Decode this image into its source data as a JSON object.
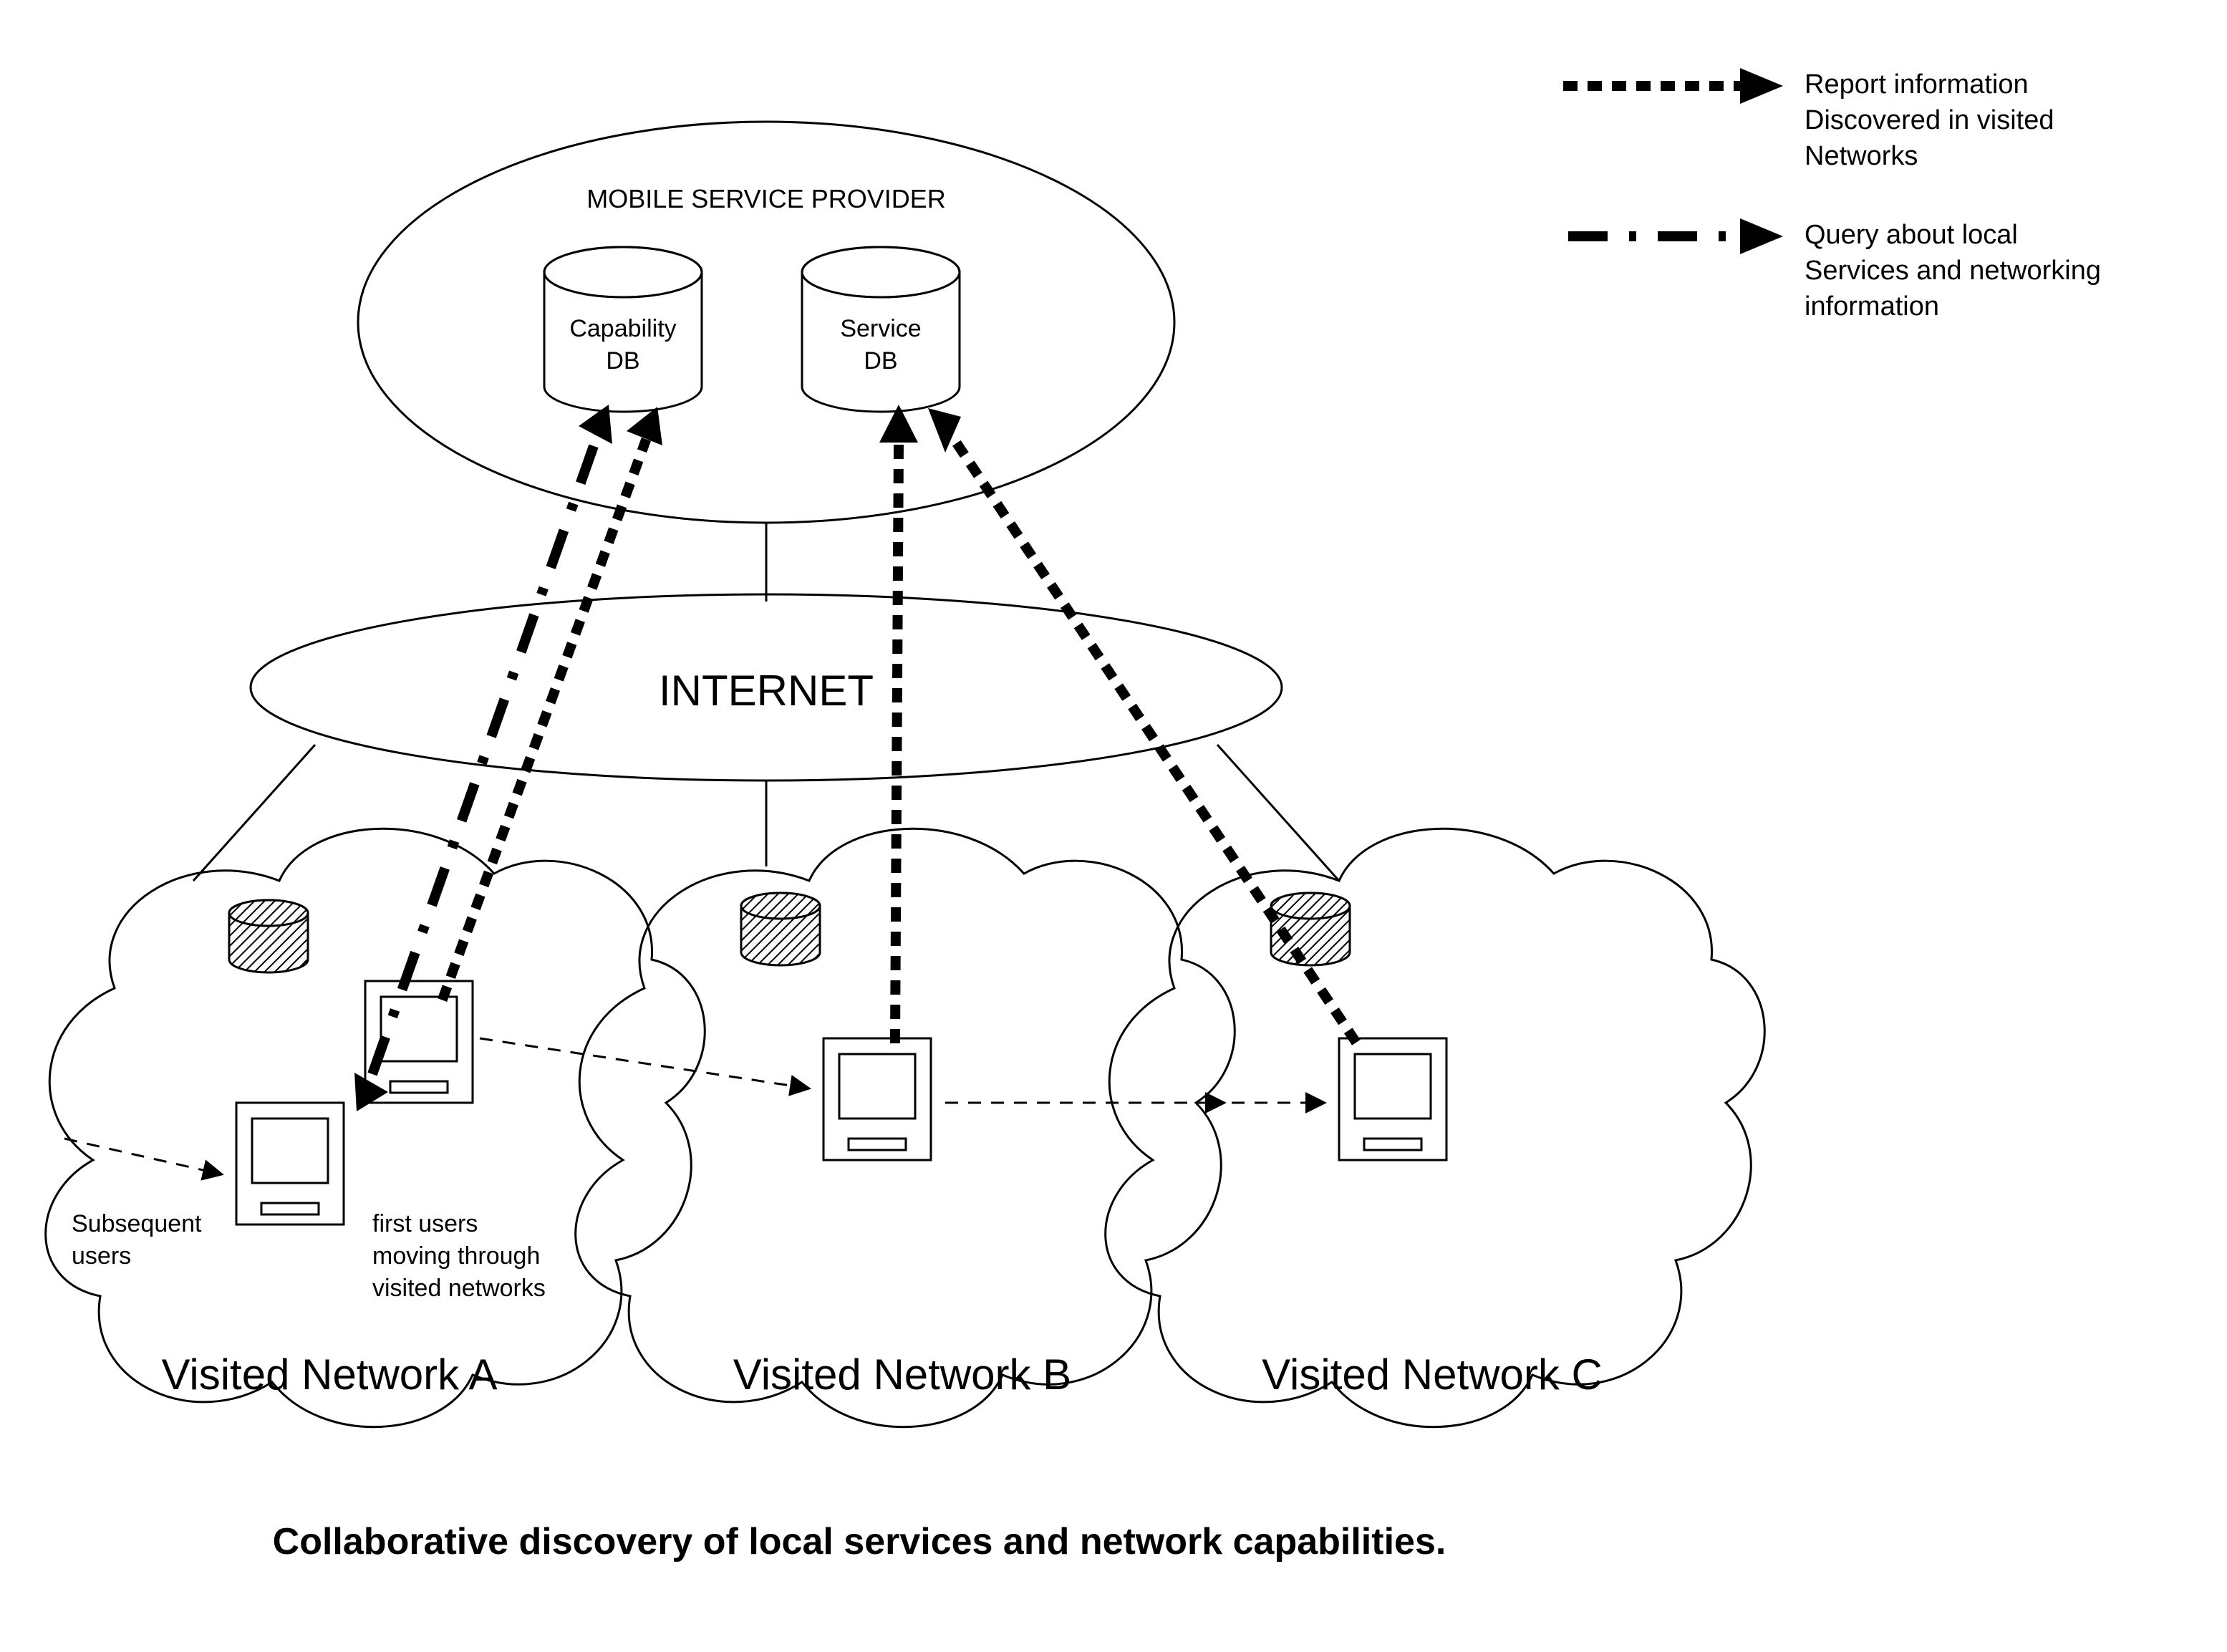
{
  "provider": {
    "title": "MOBILE SERVICE PROVIDER",
    "db1_line1": "Capability",
    "db1_line2": "DB",
    "db2_line1": "Service",
    "db2_line2": "DB"
  },
  "internet": "INTERNET",
  "networks": {
    "a": "Visited Network A",
    "b": "Visited Network B",
    "c": "Visited Network C"
  },
  "annotations": {
    "subsequent_line1": "Subsequent",
    "subsequent_line2": "users",
    "first_line1": "first users",
    "first_line2": "moving through",
    "first_line3": "visited networks"
  },
  "legend": {
    "dotted_line1": "Report information",
    "dotted_line2": "Discovered in visited",
    "dotted_line3": "Networks",
    "dashdot_line1": "Query about local",
    "dashdot_line2": "Services and networking",
    "dashdot_line3": "information"
  },
  "caption": "Collaborative discovery of local services and network capabilities."
}
